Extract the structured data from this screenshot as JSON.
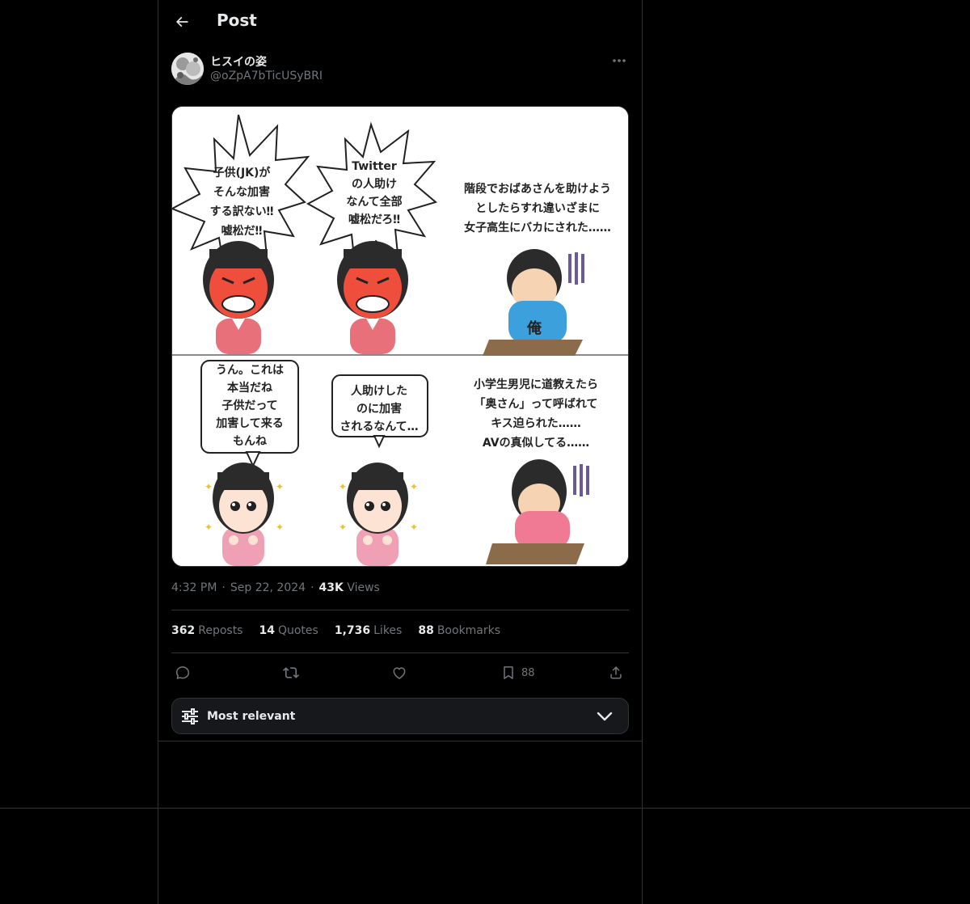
{
  "header": {
    "title": "Post"
  },
  "author": {
    "display_name": "ヒスイの姿",
    "handle": "@oZpA7bTicUSyBRI"
  },
  "media": {
    "panel_top_left": {
      "bubble": [
        "子供(JK)が",
        "そんな加害",
        "する訳ない‼",
        "嘘松だ‼"
      ]
    },
    "panel_top_middle": {
      "bubble": [
        "Twitter",
        "の人助け",
        "なんて全部",
        "嘘松だろ‼"
      ]
    },
    "panel_top_right": {
      "caption": [
        "階段でおばあさんを助けよう",
        "としたらすれ違いざまに",
        "女子高生にバカにされた……"
      ],
      "figure_label": "俺"
    },
    "panel_bottom_left": {
      "bubble": [
        "うん。これは",
        "本当だね",
        "子供だって",
        "加害して来る",
        "もんね"
      ]
    },
    "panel_bottom_middle": {
      "bubble": [
        "人助けした",
        "のに加害",
        "されるなんて…"
      ]
    },
    "panel_bottom_right": {
      "caption": [
        "小学生男児に道教えたら",
        "「奥さん」って呼ばれて",
        "キス迫られた……",
        "AVの真似してる……"
      ]
    }
  },
  "meta": {
    "time": "4:32 PM",
    "date": "Sep 22, 2024",
    "views_count": "43K",
    "views_label": "Views"
  },
  "stats": {
    "reposts_count": "362",
    "reposts_label": "Reposts",
    "quotes_count": "14",
    "quotes_label": "Quotes",
    "likes_count": "1,736",
    "likes_label": "Likes",
    "bookmarks_count": "88",
    "bookmarks_label": "Bookmarks"
  },
  "actions": {
    "bookmark_count": "88"
  },
  "sort": {
    "label": "Most relevant"
  },
  "colors": {
    "background": "#000000",
    "border": "#2f3336",
    "text_primary": "#e7e9ea",
    "text_secondary": "#71767b",
    "surface": "#16181c"
  }
}
